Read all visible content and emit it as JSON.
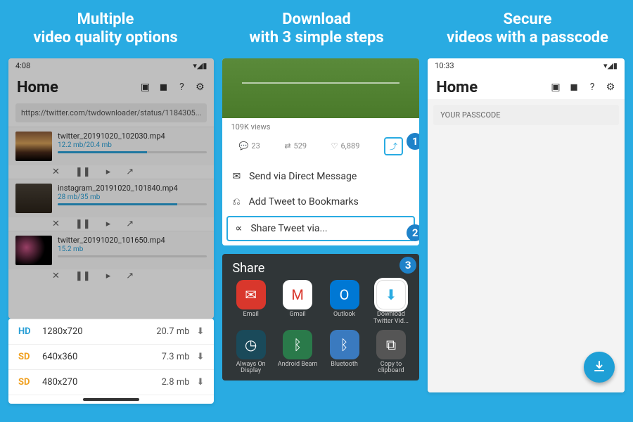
{
  "headers": [
    "Multiple\nvideo quality options",
    "Download\nwith 3 simple steps",
    "Secure\nvideos with a passcode"
  ],
  "screen1": {
    "time": "4:08",
    "title": "Home",
    "url": "https://twitter.com/twdownloader/status/1184305...",
    "downloads": [
      {
        "name": "twitter_20191020_102030.mp4",
        "size": "12.2 mb/20.4 mb",
        "pct": 60
      },
      {
        "name": "instagram_20191020_101840.mp4",
        "size": "28 mb/35 mb",
        "pct": 80
      },
      {
        "name": "twitter_20191020_101650.mp4",
        "size": "15.2 mb",
        "pct": 0
      }
    ],
    "quality": [
      {
        "badge": "HD",
        "res": "1280x720",
        "size": "20.7 mb"
      },
      {
        "badge": "SD",
        "res": "640x360",
        "size": "7.3 mb"
      },
      {
        "badge": "SD",
        "res": "480x270",
        "size": "2.8 mb"
      }
    ]
  },
  "screen2": {
    "views": "109K views",
    "comments": "23",
    "retweets": "529",
    "likes": "6,889",
    "menu": [
      "Send via Direct Message",
      "Add Tweet to Bookmarks",
      "Share Tweet via..."
    ],
    "share_title": "Share",
    "apps": [
      {
        "n": "Email",
        "c": "email"
      },
      {
        "n": "Gmail",
        "c": "gmail"
      },
      {
        "n": "Outlook",
        "c": "outlook"
      },
      {
        "n": "Download Twitter Vid...",
        "c": "dtv",
        "hl": true
      },
      {
        "n": "Always On Display",
        "c": "aod"
      },
      {
        "n": "Android Beam",
        "c": "ab"
      },
      {
        "n": "Bluetooth",
        "c": "bt"
      },
      {
        "n": "Copy to clipboard",
        "c": "clip"
      }
    ],
    "steps": [
      "1",
      "2",
      "3"
    ]
  },
  "screen3": {
    "time": "10:33",
    "title": "Home",
    "passcode": "YOUR PASSCODE"
  }
}
